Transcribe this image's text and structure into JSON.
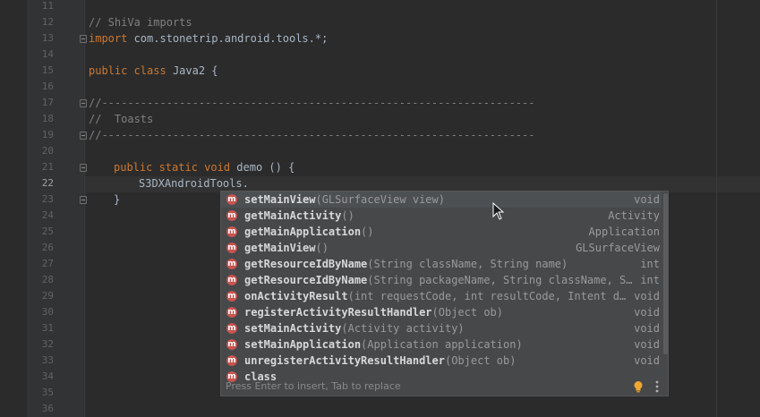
{
  "editor": {
    "line_numbers": [
      "11",
      "12",
      "13",
      "14",
      "15",
      "16",
      "17",
      "18",
      "19",
      "20",
      "21",
      "22",
      "23",
      "24",
      "25",
      "26",
      "27",
      "28",
      "29",
      "30",
      "31",
      "32",
      "33",
      "34",
      "35",
      "36"
    ],
    "current_line": "22",
    "lines": {
      "l12_comment": "// ShiVa imports",
      "l13_kw": "import",
      "l13_rest": " com.stonetrip.android.tools.*;",
      "l15_kw1": "public",
      "l15_kw2": " class",
      "l15_name": " Java2 {",
      "l17": "//-------------------------------------------------------------------",
      "l18": "//  Toasts",
      "l19": "//-------------------------------------------------------------------",
      "l21_kw": "public static void",
      "l21_rest": " demo () {",
      "l22": "S3DXAndroidTools.",
      "l23": "}"
    }
  },
  "completion": {
    "items": [
      {
        "name": "setMainView",
        "params": "(GLSurfaceView view)",
        "ret": "void"
      },
      {
        "name": "getMainActivity",
        "params": "()",
        "ret": "Activity"
      },
      {
        "name": "getMainApplication",
        "params": "()",
        "ret": "Application"
      },
      {
        "name": "getMainView",
        "params": "()",
        "ret": "GLSurfaceView"
      },
      {
        "name": "getResourceIdByName",
        "params": "(String className, String name)",
        "ret": "int"
      },
      {
        "name": "getResourceIdByName",
        "params": "(String packageName, String className, S…",
        "ret": "int"
      },
      {
        "name": "onActivityResult",
        "params": "(int requestCode, int resultCode, Intent d…",
        "ret": "void"
      },
      {
        "name": "registerActivityResultHandler",
        "params": "(Object ob)",
        "ret": "void"
      },
      {
        "name": "setMainActivity",
        "params": "(Activity activity)",
        "ret": "void"
      },
      {
        "name": "setMainApplication",
        "params": "(Application application)",
        "ret": "void"
      },
      {
        "name": "unregisterActivityResultHandler",
        "params": "(Object ob)",
        "ret": "void"
      },
      {
        "name": "class",
        "params": "",
        "ret": ""
      }
    ],
    "icon_letter": "m",
    "footer_hint": "Press Enter to insert, Tab to replace"
  },
  "icons": {
    "method": "method-icon",
    "bulb": "lightbulb-icon",
    "more": "more-vertical-icon",
    "cursor": "mouse-cursor-icon"
  },
  "colors": {
    "background": "#2b2b2b",
    "keyword": "#cc7832",
    "comment": "#808080",
    "method_icon": "#c75450",
    "bulb": "#f0a732"
  }
}
